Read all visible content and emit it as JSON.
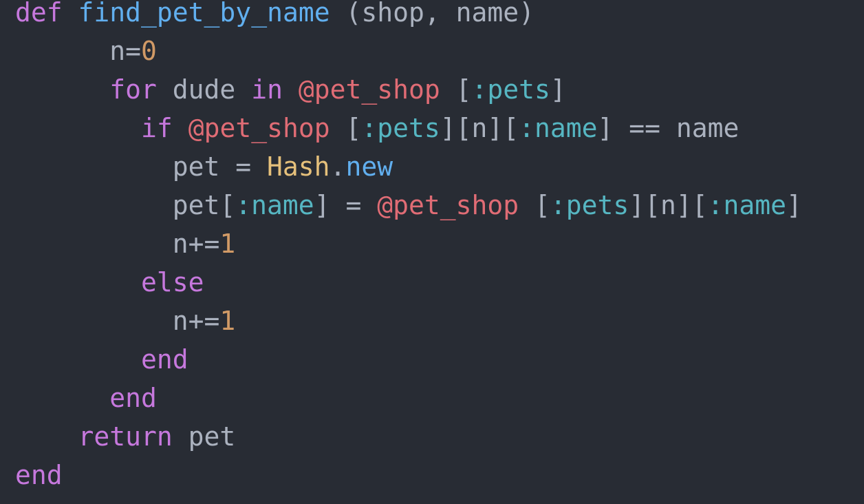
{
  "colors": {
    "background": "#282c34",
    "plain": "#abb2bf",
    "keyword": "#c678dd",
    "function": "#61afef",
    "number": "#d19a66",
    "instance_var": "#e06c75",
    "symbol": "#56b6c2",
    "constant": "#e5c07b"
  },
  "code": {
    "lines": [
      {
        "tokens": [
          {
            "text": "def",
            "kind": "keyword"
          },
          {
            "text": " ",
            "kind": "plain"
          },
          {
            "text": "find_pet_by_name",
            "kind": "function"
          },
          {
            "text": " (shop, name)",
            "kind": "plain"
          }
        ]
      },
      {
        "tokens": [
          {
            "text": "      n=",
            "kind": "plain"
          },
          {
            "text": "0",
            "kind": "number"
          }
        ]
      },
      {
        "tokens": [
          {
            "text": "      ",
            "kind": "plain"
          },
          {
            "text": "for",
            "kind": "keyword"
          },
          {
            "text": " dude ",
            "kind": "plain"
          },
          {
            "text": "in",
            "kind": "keyword"
          },
          {
            "text": " ",
            "kind": "plain"
          },
          {
            "text": "@pet_shop",
            "kind": "instance_var"
          },
          {
            "text": " [",
            "kind": "plain"
          },
          {
            "text": ":pets",
            "kind": "symbol"
          },
          {
            "text": "]",
            "kind": "plain"
          }
        ]
      },
      {
        "tokens": [
          {
            "text": "        ",
            "kind": "plain"
          },
          {
            "text": "if",
            "kind": "keyword"
          },
          {
            "text": " ",
            "kind": "plain"
          },
          {
            "text": "@pet_shop",
            "kind": "instance_var"
          },
          {
            "text": " [",
            "kind": "plain"
          },
          {
            "text": ":pets",
            "kind": "symbol"
          },
          {
            "text": "][n][",
            "kind": "plain"
          },
          {
            "text": ":name",
            "kind": "symbol"
          },
          {
            "text": "] == name",
            "kind": "plain"
          }
        ]
      },
      {
        "tokens": [
          {
            "text": "          pet = ",
            "kind": "plain"
          },
          {
            "text": "Hash",
            "kind": "constant"
          },
          {
            "text": ".",
            "kind": "plain"
          },
          {
            "text": "new",
            "kind": "function"
          }
        ]
      },
      {
        "tokens": [
          {
            "text": "          pet[",
            "kind": "plain"
          },
          {
            "text": ":name",
            "kind": "symbol"
          },
          {
            "text": "] = ",
            "kind": "plain"
          },
          {
            "text": "@pet_shop",
            "kind": "instance_var"
          },
          {
            "text": " [",
            "kind": "plain"
          },
          {
            "text": ":pets",
            "kind": "symbol"
          },
          {
            "text": "][n][",
            "kind": "plain"
          },
          {
            "text": ":name",
            "kind": "symbol"
          },
          {
            "text": "]",
            "kind": "plain"
          }
        ]
      },
      {
        "tokens": [
          {
            "text": "          n+=",
            "kind": "plain"
          },
          {
            "text": "1",
            "kind": "number"
          }
        ]
      },
      {
        "tokens": [
          {
            "text": "        ",
            "kind": "plain"
          },
          {
            "text": "else",
            "kind": "keyword"
          }
        ]
      },
      {
        "tokens": [
          {
            "text": "          n+=",
            "kind": "plain"
          },
          {
            "text": "1",
            "kind": "number"
          }
        ]
      },
      {
        "tokens": [
          {
            "text": "        ",
            "kind": "plain"
          },
          {
            "text": "end",
            "kind": "keyword"
          }
        ]
      },
      {
        "tokens": [
          {
            "text": "      ",
            "kind": "plain"
          },
          {
            "text": "end",
            "kind": "keyword"
          }
        ]
      },
      {
        "tokens": [
          {
            "text": "    ",
            "kind": "plain"
          },
          {
            "text": "return",
            "kind": "keyword"
          },
          {
            "text": " pet",
            "kind": "plain"
          }
        ]
      },
      {
        "tokens": [
          {
            "text": "end",
            "kind": "keyword"
          }
        ]
      }
    ]
  }
}
